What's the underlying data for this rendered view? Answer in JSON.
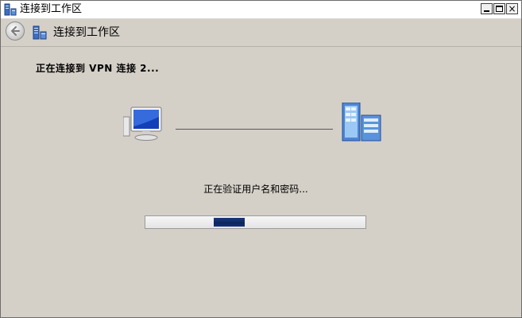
{
  "window": {
    "title": "连接到工作区",
    "controls": {
      "close_glyph": "×"
    }
  },
  "nav": {
    "title": "连接到工作区"
  },
  "status": {
    "heading": "正在连接到 VPN 连接 2...",
    "progress_text": "正在验证用户名和密码...",
    "progress_fraction": 0.31,
    "progress_segment_fraction": 0.14
  },
  "icons": {
    "title": "network-workplace-icon",
    "back": "back-arrow-icon",
    "nav": "network-workplace-icon",
    "local": "computer-icon",
    "remote": "server-icon"
  },
  "colors": {
    "progress_fill": "#0b2460",
    "window_bg": "#d4d0c8"
  }
}
